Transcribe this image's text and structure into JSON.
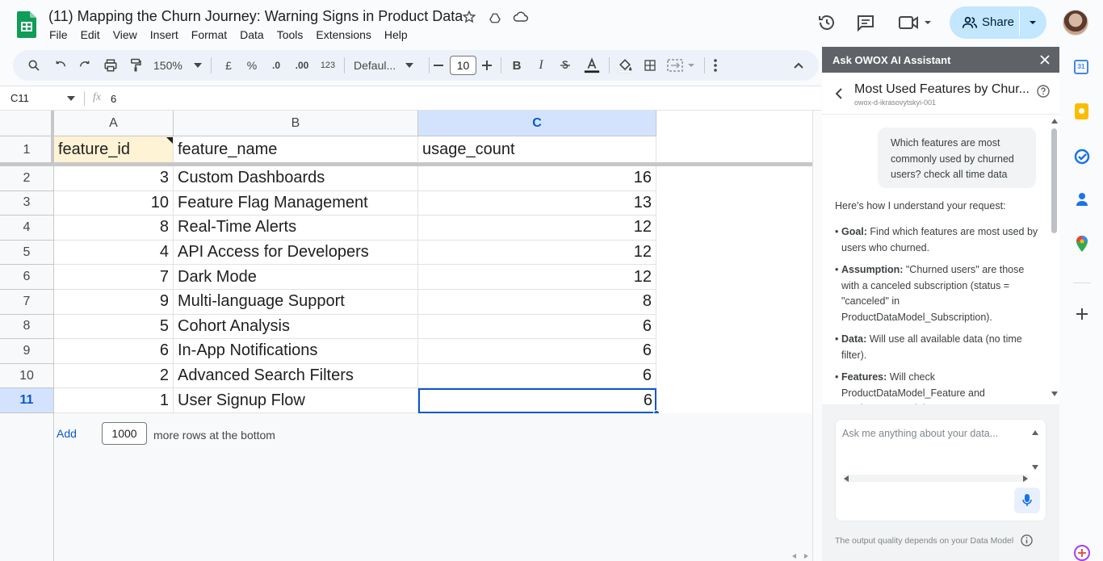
{
  "app": {
    "doc_title": "(11) Mapping the Churn Journey: Warning Signs in Product Data",
    "menu": [
      "File",
      "Edit",
      "View",
      "Insert",
      "Format",
      "Data",
      "Tools",
      "Extensions",
      "Help"
    ],
    "share_label": "Share"
  },
  "toolbar": {
    "zoom": "150%",
    "currency": "£",
    "percent": "%",
    "dec_decrease": ".0",
    "dec_increase": ".00",
    "number_format": "123",
    "font_family": "Defaul...",
    "font_size": "10"
  },
  "formula_bar": {
    "cell_ref": "C11",
    "fx_symbol": "fx",
    "value": "6"
  },
  "sheet": {
    "columns": [
      "A",
      "B",
      "C"
    ],
    "header_row": {
      "row": "1",
      "a": "feature_id",
      "b": "feature_name",
      "c": "usage_count"
    },
    "rows": [
      {
        "row": "2",
        "a": "3",
        "b": "Custom Dashboards",
        "c": "16"
      },
      {
        "row": "3",
        "a": "10",
        "b": "Feature Flag Management",
        "c": "13"
      },
      {
        "row": "4",
        "a": "8",
        "b": "Real-Time Alerts",
        "c": "12"
      },
      {
        "row": "5",
        "a": "4",
        "b": "API Access for Developers",
        "c": "12"
      },
      {
        "row": "6",
        "a": "7",
        "b": "Dark Mode",
        "c": "12"
      },
      {
        "row": "7",
        "a": "9",
        "b": "Multi-language Support",
        "c": "8"
      },
      {
        "row": "8",
        "a": "5",
        "b": "Cohort Analysis",
        "c": "6"
      },
      {
        "row": "9",
        "a": "6",
        "b": "In-App Notifications",
        "c": "6"
      },
      {
        "row": "10",
        "a": "2",
        "b": "Advanced Search Filters",
        "c": "6"
      },
      {
        "row": "11",
        "a": "1",
        "b": "User Signup Flow",
        "c": "6"
      }
    ],
    "add_label": "Add",
    "add_rows_value": "1000",
    "add_rows_suffix": "more rows at the bottom"
  },
  "panel": {
    "header": "Ask OWOX AI Assistant",
    "chat_title": "Most Used Features by Chur...",
    "chat_subtitle": "owox-d-ikrasovytskyi-001",
    "user_message": "Which features are most commonly used by churned users? check all time data",
    "assistant_intro": "Here's how I understand your request:",
    "bullets": [
      {
        "label": "Goal:",
        "text": " Find which features are most used by users who churned."
      },
      {
        "label": "Assumption:",
        "text": " \"Churned users\" are those with a canceled subscription (status = \"canceled\" in ProductDataModel_Subscription)."
      },
      {
        "label": "Data:",
        "text": " Will use all available data (no time filter)."
      },
      {
        "label": "Features:",
        "text": " Will check ProductDataModel_Feature and ProductDataModel_Fe..."
      }
    ],
    "input_placeholder": "Ask me anything about your data...",
    "footer_note": "The output quality depends on your Data Model"
  },
  "colors": {
    "accent_blue": "#0b57d0",
    "share_bg": "#c2e7ff",
    "selected_header": "#d3e3fd",
    "cell_highlight": "#fef3d4",
    "panel_header_bg": "#5f6368"
  }
}
